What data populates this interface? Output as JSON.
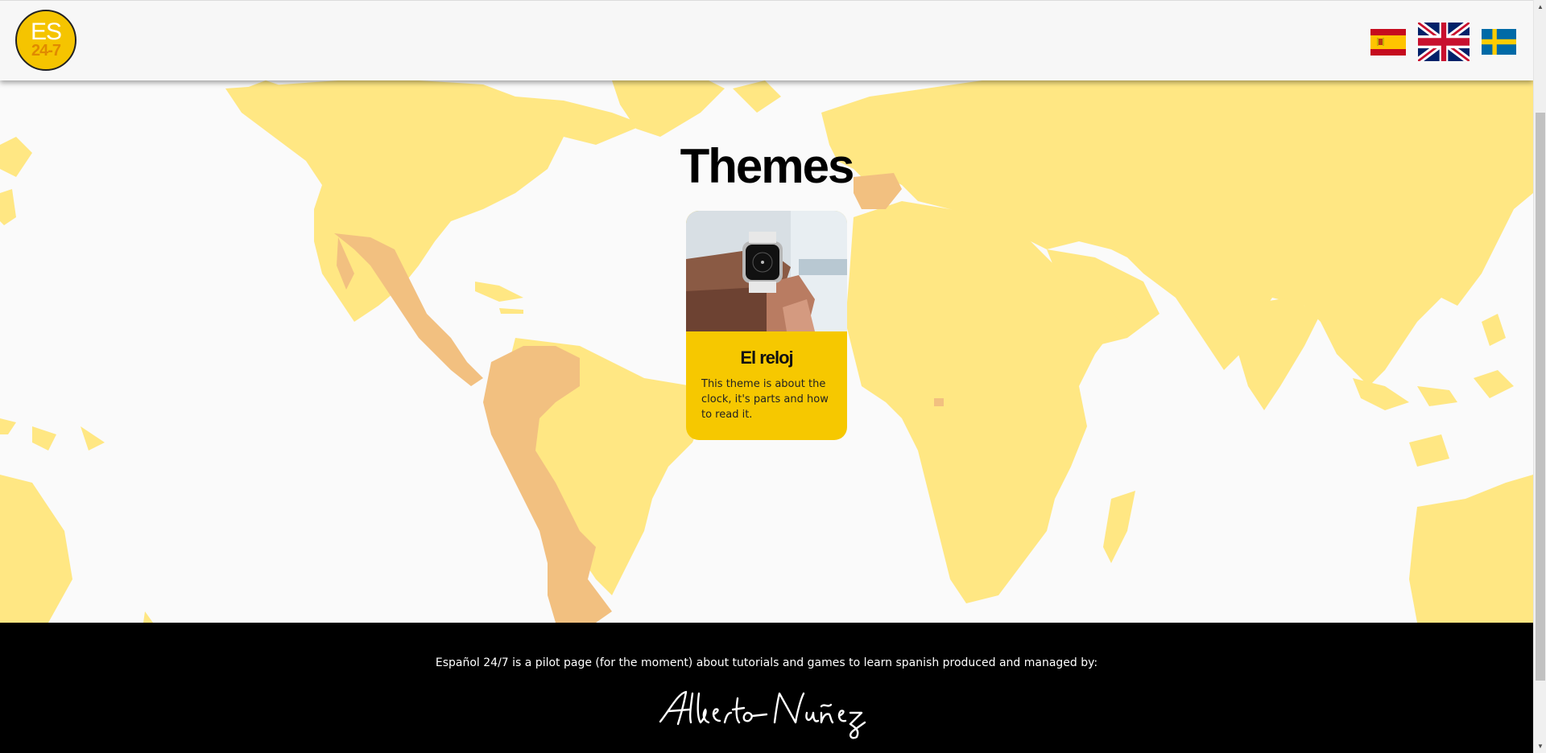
{
  "header": {
    "logo": {
      "top_text": "ES",
      "bottom_text": "24-7"
    },
    "languages": [
      {
        "name": "Español",
        "icon": "spain-flag-icon"
      },
      {
        "name": "English",
        "icon": "uk-flag-icon"
      },
      {
        "name": "Svenska",
        "icon": "sweden-flag-icon"
      }
    ]
  },
  "main": {
    "title": "Themes",
    "cards": [
      {
        "title": "El reloj",
        "description": "This theme is about the clock, it's parts and how to read it.",
        "image_icon": "smartwatch-photo"
      }
    ]
  },
  "footer": {
    "text": "Español 24/7 is a pilot page (for the moment) about tutorials and games to learn spanish produced and managed by:",
    "signature": "Alberto Nuñez"
  },
  "colors": {
    "accent": "#f6c800",
    "map_land": "#ffe783",
    "map_spanish": "#f2c080",
    "footer_bg": "#000000"
  }
}
